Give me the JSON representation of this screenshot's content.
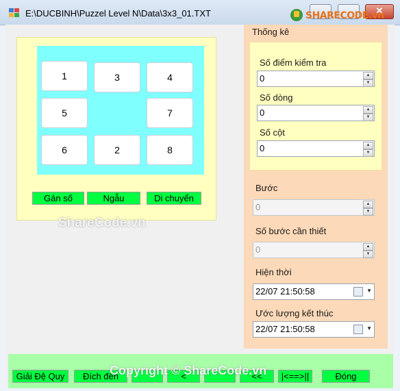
{
  "window": {
    "title": "E:\\DUCBINH\\Puzzel Level N\\Data\\3x3_01.TXT",
    "logo_text": "SHARECODE.vn"
  },
  "board": {
    "tiles": [
      {
        "label": "1"
      },
      {
        "label": "3"
      },
      {
        "label": "4"
      },
      {
        "label": "5"
      },
      {
        "label": ""
      },
      {
        "label": "7"
      },
      {
        "label": "6"
      },
      {
        "label": "2"
      },
      {
        "label": "8"
      }
    ]
  },
  "board_buttons": {
    "assign": "Gán số",
    "random": "Ngẫu",
    "move": "Di chuyển"
  },
  "stats": {
    "group_title": "Thống kê",
    "check_points_label": "Số điểm kiểm tra",
    "check_points_value": "0",
    "rows_label": "Số dòng",
    "rows_value": "0",
    "cols_label": "Số cột",
    "cols_value": "0",
    "step_label": "Bước",
    "step_value": "0",
    "needed_steps_label": "Số bước cần thiết",
    "needed_steps_value": "0",
    "current_label": "Hiện thời",
    "current_value": "22/07 21:50:58",
    "estimate_label": "Ước lượng kết thúc",
    "estimate_value": "22/07 21:50:58"
  },
  "bottom_buttons": {
    "recursive": "Giải Đệ Quy",
    "goal": "Đích đến",
    "btn3": "",
    "btn4": "<",
    "btn5": "",
    "btn6": "<<",
    "btn7": "|<==>||",
    "close": "Đóng"
  },
  "watermarks": {
    "mid": "ShareCode.vn",
    "bottom": "Copyright © ShareCode.vn"
  },
  "colors": {
    "board_bg": "#80ffff",
    "panel_bg": "#ffffc0",
    "stats_bg": "#fcd9b8",
    "button_green": "#00ff40",
    "strip_green": "#a8ffa8"
  }
}
